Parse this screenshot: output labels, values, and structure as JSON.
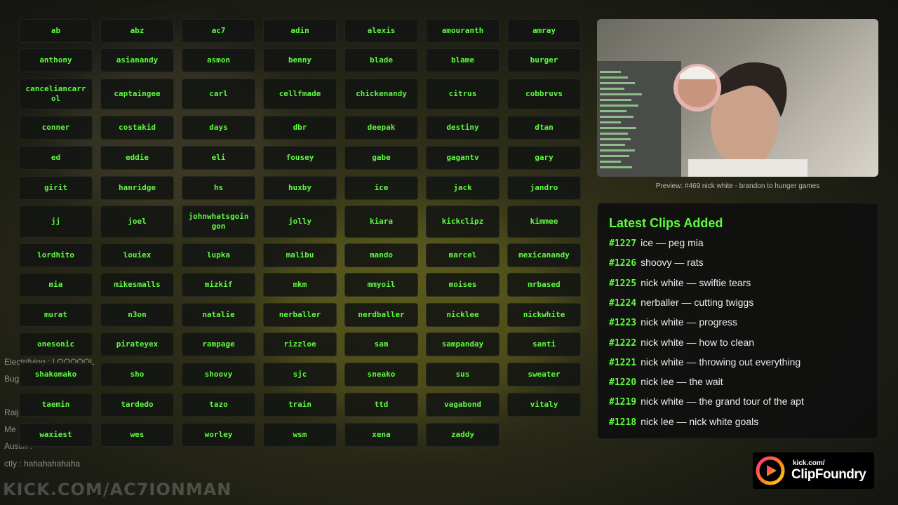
{
  "streamers": [
    [
      "ab",
      "abz",
      "ac7",
      "adin",
      "alexis",
      "amouranth",
      "amray"
    ],
    [
      "anthony",
      "asianandy",
      "asmon",
      "benny",
      "blade",
      "blame",
      "burger"
    ],
    [
      "canceliancarrol",
      "captaingee",
      "carl",
      "cellfmade",
      "chickenandy",
      "citrus",
      "cobbruvs"
    ],
    [
      "conner",
      "costakid",
      "days",
      "dbr",
      "deepak",
      "destiny",
      "dtan"
    ],
    [
      "ed",
      "eddie",
      "eli",
      "fousey",
      "gabe",
      "gagantv",
      "gary"
    ],
    [
      "girit",
      "hanridge",
      "hs",
      "huxby",
      "ice",
      "jack",
      "jandro"
    ],
    [
      "jj",
      "joel",
      "johnwhatsgoingon",
      "jolly",
      "kiara",
      "kickclipz",
      "kimmee"
    ],
    [
      "lordhito",
      "louiex",
      "lupka",
      "malibu",
      "mando",
      "marcel",
      "mexicanandy"
    ],
    [
      "mia",
      "mikesmalls",
      "mizkif",
      "mkm",
      "mmyoil",
      "moises",
      "mrbased"
    ],
    [
      "murat",
      "n3on",
      "natalie",
      "nerballer",
      "nerdballer",
      "nicklee",
      "nickwhite"
    ],
    [
      "onesonic",
      "pirateyex",
      "rampage",
      "rizzloe",
      "sam",
      "sampanday",
      "santi"
    ],
    [
      "shakomako",
      "sho",
      "shoovy",
      "sjc",
      "sneako",
      "sus",
      "sweater"
    ],
    [
      "taemin",
      "tardedo",
      "tazo",
      "train",
      "ttd",
      "vagabond",
      "vitaly"
    ],
    [
      "waxiest",
      "wes",
      "worley",
      "wsm",
      "xena",
      "zaddy"
    ]
  ],
  "streamer_display": {
    "canceliancarrol": "canceliancarr\nol",
    "johnwhatsgoingon": "johnwhatsgoin\ngon"
  },
  "preview": {
    "caption": "Preview: #469 nick white - brandon to hunger games"
  },
  "clips_panel": {
    "title": "Latest Clips Added",
    "clips": [
      {
        "num": "#1227",
        "text": "ice — peg mia"
      },
      {
        "num": "#1226",
        "text": "shoovy — rats"
      },
      {
        "num": "#1225",
        "text": "nick white — swiftie tears"
      },
      {
        "num": "#1224",
        "text": "nerballer — cutting twiggs"
      },
      {
        "num": "#1223",
        "text": "nick white — progress"
      },
      {
        "num": "#1222",
        "text": "nick white — how to clean"
      },
      {
        "num": "#1221",
        "text": "nick white — throwing out everything"
      },
      {
        "num": "#1220",
        "text": "nick lee — the wait"
      },
      {
        "num": "#1219",
        "text": "nick white — the grand tour of the apt"
      },
      {
        "num": "#1218",
        "text": "nick lee — nick white goals"
      }
    ]
  },
  "chat_overlay": {
    "lines": [
      "Electrifying : LOOOOOL",
      "Bug",
      "Raij",
      "Me",
      "Austin :",
      "ctly : hahahahahaha"
    ]
  },
  "stream_url": "KICK.COM/AC7IONMAN",
  "logo": {
    "small": "kick.com/",
    "big": "ClipFoundry"
  },
  "colors": {
    "accent": "#5dfb3f",
    "tile_bg": "#121412",
    "panel_bg": "#0e100e"
  }
}
